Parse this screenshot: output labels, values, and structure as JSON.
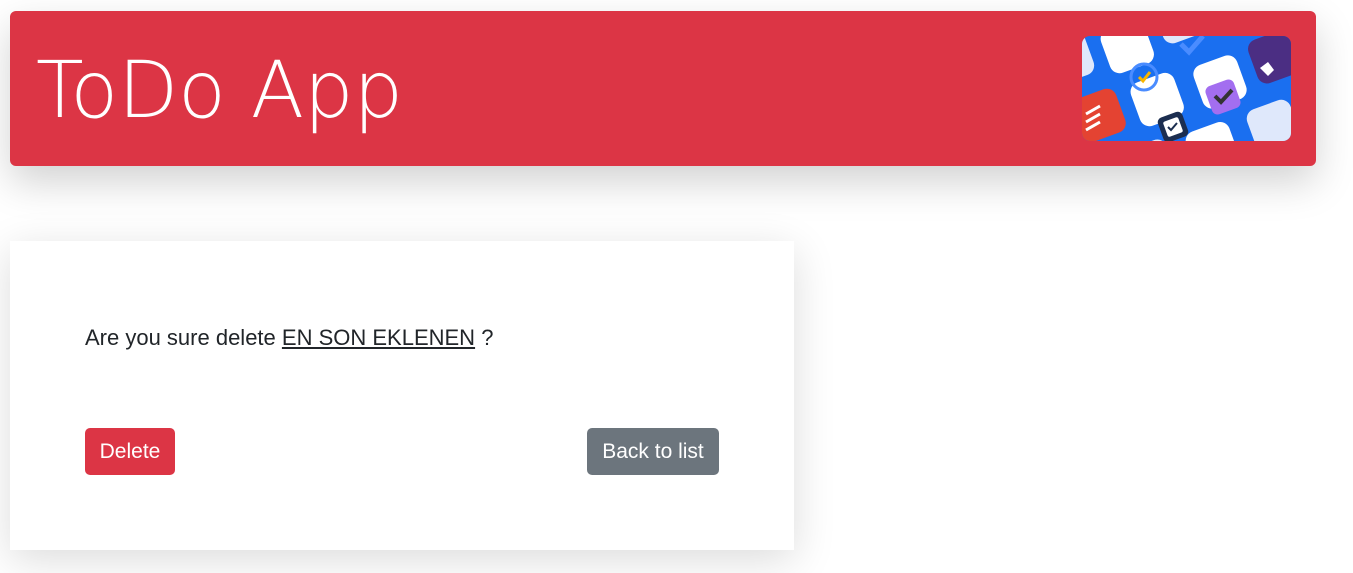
{
  "header": {
    "title": "ToDo App",
    "logo_icon": "todo-apps-collage-icon",
    "background_color": "#dc3545"
  },
  "confirm": {
    "prefix": "Are you sure delete ",
    "item_name": "EN SON EKLENEN",
    "suffix": " ?"
  },
  "buttons": {
    "delete_label": "Delete",
    "delete_color": "#dc3545",
    "back_label": "Back to list",
    "back_color": "#6c757d"
  }
}
